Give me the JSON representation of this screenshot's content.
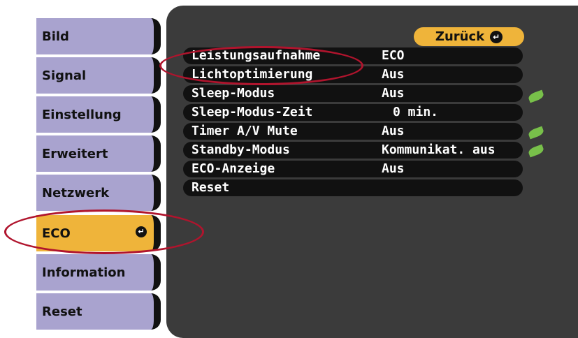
{
  "menu": {
    "items": [
      {
        "label": "Bild"
      },
      {
        "label": "Signal"
      },
      {
        "label": "Einstellung"
      },
      {
        "label": "Erweitert"
      },
      {
        "label": "Netzwerk"
      },
      {
        "label": "ECO"
      },
      {
        "label": "Information"
      },
      {
        "label": "Reset"
      }
    ]
  },
  "panel": {
    "back_label": "Zurück",
    "rows": [
      {
        "label": "Leistungsaufnahme",
        "value": "ECO",
        "leaf": false
      },
      {
        "label": "Lichtoptimierung",
        "value": "Aus",
        "leaf": false
      },
      {
        "label": "Sleep-Modus",
        "value": "Aus",
        "leaf": true
      },
      {
        "label": "Sleep-Modus-Zeit",
        "value": "0 min.",
        "leaf": false
      },
      {
        "label": "Timer A/V Mute",
        "value": "Aus",
        "leaf": true
      },
      {
        "label": "Standby-Modus",
        "value": "Kommunikat. aus",
        "leaf": true
      },
      {
        "label": "ECO-Anzeige",
        "value": "Aus",
        "leaf": false
      },
      {
        "label": "Reset",
        "value": "",
        "leaf": false
      }
    ]
  },
  "colors": {
    "accent": "#efb43a",
    "menu_item": "#a9a3cf",
    "panel": "#3b3b3b",
    "row": "#111111",
    "leaf": "#78c04a",
    "annotation": "#b0142d"
  }
}
